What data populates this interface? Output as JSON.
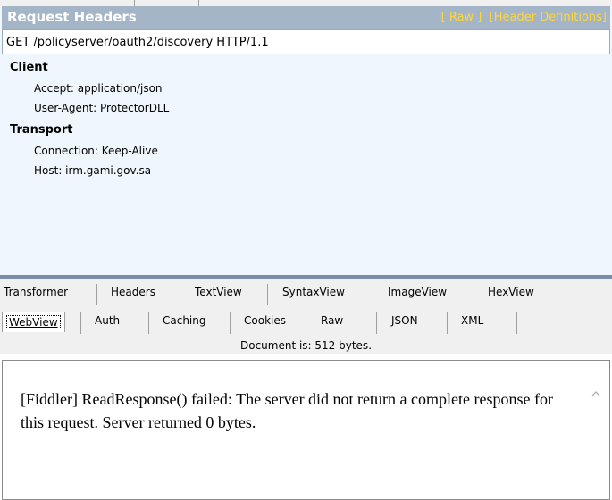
{
  "request": {
    "title": "Request Headers",
    "links": [
      "[ Raw ]",
      "[Header Definitions]"
    ],
    "request_line": "GET /policyserver/oauth2/discovery HTTP/1.1",
    "groups": [
      {
        "name": "Client",
        "items": [
          "Accept: application/json",
          "User-Agent: ProtectorDLL"
        ]
      },
      {
        "name": "Transport",
        "items": [
          "Connection: Keep-Alive",
          "Host: irm.gami.gov.sa"
        ]
      }
    ]
  },
  "tabs_row1": [
    "Transformer",
    "Headers",
    "TextView",
    "SyntaxView",
    "ImageView",
    "HexView"
  ],
  "tabs_row2": [
    "WebView",
    "Auth",
    "Caching",
    "Cookies",
    "Raw",
    "JSON",
    "XML"
  ],
  "selected_tab": "WebView",
  "document_info": "Document is: 512 bytes.",
  "web_content": "[Fiddler] ReadResponse() failed: The server did not return a complete response for this request. Server returned 0 bytes.",
  "colors": {
    "header_bar": "#a4b5c8",
    "header_links": "#ffd63b",
    "panel_bg": "#f0f6fd",
    "splitter": "#7b8ea5"
  },
  "icons": {
    "scroll_up": "chevron-up-icon"
  }
}
